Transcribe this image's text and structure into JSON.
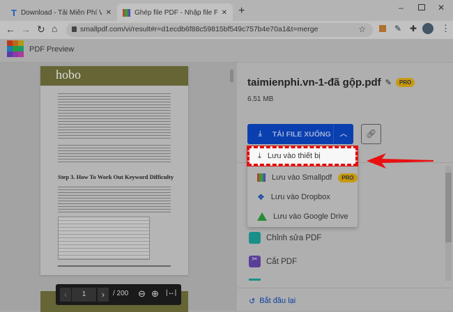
{
  "browser": {
    "tabs": [
      {
        "title": "Download - Tải Miễn Phí VN - Ph",
        "active": false
      },
      {
        "title": "Ghép file PDF - Nhập file PDF trự",
        "active": true
      }
    ],
    "url": "smallpdf.com/vi/result#r=d1ecdb6f88c59815bf549c757b4e70a1&t=merge"
  },
  "header": {
    "title": "PDF Preview"
  },
  "preview": {
    "current_page": "1",
    "total_pages": "/ 200",
    "doc_heading": "Step 3. How To Work Out Keyword Difficulty",
    "logo": "hobo"
  },
  "file": {
    "name": "taimienphi.vn-1-đã gộp.pdf",
    "badge": "PRO",
    "size": "6.51 MB"
  },
  "download": {
    "label": "TẢI FILE XUỐNG",
    "options": [
      {
        "label": "Lưu vào thiết bị"
      },
      {
        "label": "Lưu vào Smallpdf",
        "badge": "PRO"
      },
      {
        "label": "Lưu vào Dropbox"
      },
      {
        "label": "Lưu vào Google Drive"
      }
    ]
  },
  "tools": [
    {
      "label": "Chỉnh sửa PDF",
      "color": "#1a8f8a"
    },
    {
      "label": "Cắt PDF",
      "color": "#5a3f9a"
    }
  ],
  "restart": "Bắt đầu lại",
  "colors": {
    "accent": "#0a3fb0",
    "highlight": "#e01010"
  }
}
